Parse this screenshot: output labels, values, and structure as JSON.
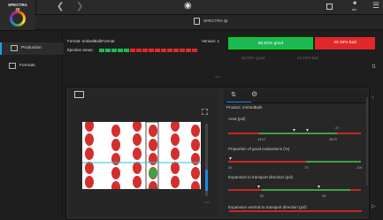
{
  "app": {
    "logo_line1": "SPECTRA",
    "logo_line2": "QI",
    "title": "SPECTRA QI",
    "header_right_label": "am"
  },
  "sidebar": {
    "items": [
      {
        "label": "Production",
        "icon": "chart-icon",
        "active": true
      },
      {
        "label": "Formats",
        "icon": "formats-icon",
        "active": false
      }
    ]
  },
  "format": {
    "format_label": "Format: embedBulkFormat",
    "ejection_label": "Ejection areas:",
    "version_label": "Version: 1",
    "good_label": "56.82% good",
    "bad_label": "43.18% bad",
    "good_secondary": "56.82% good",
    "bad_secondary": "43.18% bad",
    "ejection_states": [
      "green",
      "green",
      "green",
      "green",
      "green",
      "red",
      "red",
      "red",
      "red",
      "red",
      "red",
      "red",
      "red",
      "red",
      "red",
      "red"
    ]
  },
  "product": {
    "title": "Product: embedBulk",
    "metrics": [
      {
        "label": "Area (pxl)",
        "min": "4410",
        "max": "4875",
        "top_value": "4?"
      },
      {
        "label": "Proportion of good evaluations (%)",
        "min": "25",
        "mid": "70",
        "max": "100"
      },
      {
        "label": "Expansion in transport direction (pxl)",
        "min": "52",
        "max": "56"
      },
      {
        "label": "Expansion vertical to transport direction (pxl)"
      }
    ]
  },
  "colors": {
    "accent": "#1e88e5",
    "good": "#1db954",
    "bad": "#e0282b"
  }
}
